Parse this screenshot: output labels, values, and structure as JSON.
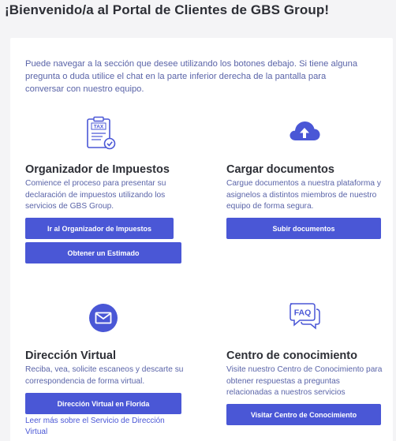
{
  "header": {
    "title": "¡Bienvenido/a al Portal de Clientes de GBS Group!"
  },
  "intro": {
    "text": "Puede navegar a la sección que desee utilizando los botones debajo. Si tiene alguna pregunta o duda utilice el chat en la parte inferior derecha de la pantalla para conversar con nuestro equipo."
  },
  "sections": {
    "taxes": {
      "icon": "tax-document-icon",
      "icon_label": "TAX",
      "title": "Organizador de Impuestos",
      "description": "Comience el proceso para presentar su declaración de impuestos utilizando los servicios de GBS Group.",
      "primary_button": "Ir al Organizador de Impuestos",
      "secondary_button": "Obtener un Estimado"
    },
    "upload": {
      "icon": "cloud-upload-icon",
      "title": "Cargar documentos",
      "description": "Cargue documentos a nuestra plataforma y asignelos a distintos miembros de nuestro equipo de forma segura.",
      "button": "Subir documentos"
    },
    "virtual_address": {
      "icon": "mail-envelope-icon",
      "title": "Dirección Virtual",
      "description": "Reciba, vea, solicite escaneos y descarte su correspondencia de forma virtual.",
      "button": "Dirección Virtual en Florida",
      "link": "Leer más sobre el Servicio de Dirección Virtual"
    },
    "knowledge": {
      "icon": "faq-chat-icon",
      "icon_label": "FAQ",
      "title": "Centro de conocimiento",
      "description": "Visite nuestro Centro de Conocimiento para obtener respuestas a preguntas relacionadas a nuestros servicios",
      "button": "Visitar Centro de Conocimiento"
    }
  },
  "colors": {
    "accent": "#4a57d6",
    "text_muted": "#5a64a8",
    "heading": "#2d2f36",
    "background": "#f4f4f6"
  }
}
